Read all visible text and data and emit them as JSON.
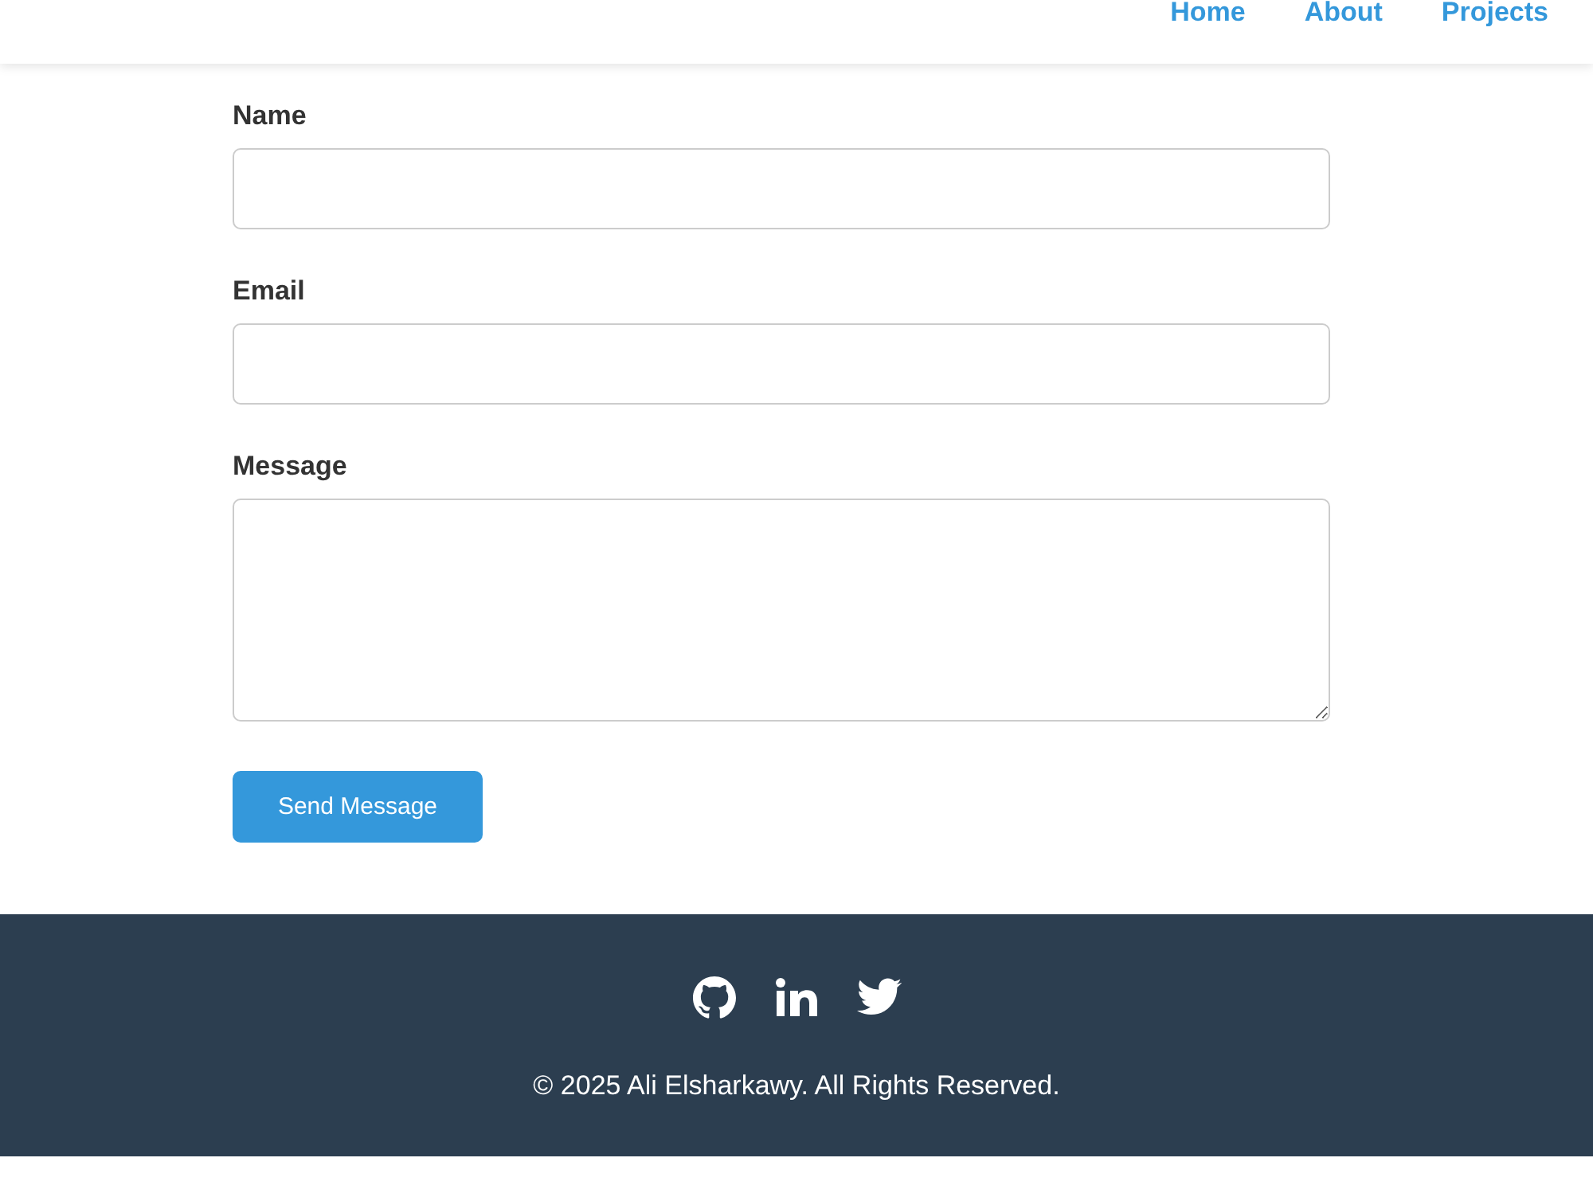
{
  "header": {
    "nav": [
      "Home",
      "About",
      "Projects"
    ]
  },
  "form": {
    "fields": [
      {
        "label": "Name",
        "kind": "input"
      },
      {
        "label": "Email",
        "kind": "input"
      },
      {
        "label": "Message",
        "kind": "textarea"
      }
    ],
    "submit": "Send Message"
  },
  "footer": {
    "copyright": "© 2025 Ali Elsharkawy. All Rights Reserved."
  }
}
